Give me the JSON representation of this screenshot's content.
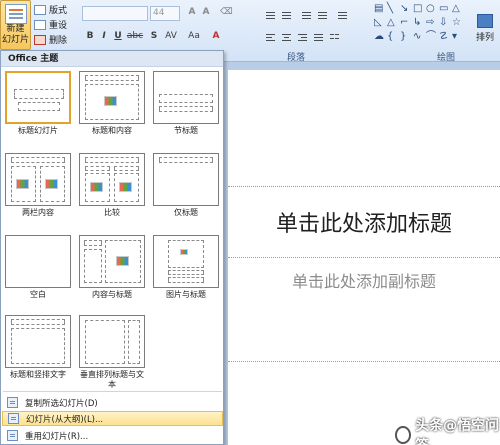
{
  "ribbon": {
    "new_slide_label_1": "新建",
    "new_slide_label_2": "幻灯片",
    "layout_label": "版式",
    "reset_label": "重设",
    "delete_label": "删除",
    "font_size": "44",
    "bold": "B",
    "italic": "I",
    "underline": "U",
    "strike": "abc",
    "shadow": "S",
    "spacing": "AV",
    "paragraph_group": "段落",
    "drawing_group": "绘图",
    "arrange_label": "排列"
  },
  "menu": {
    "header": "Office 主题",
    "layouts": [
      {
        "label": "标题幻灯片"
      },
      {
        "label": "标题和内容"
      },
      {
        "label": "节标题"
      },
      {
        "label": "两栏内容"
      },
      {
        "label": "比较"
      },
      {
        "label": "仅标题"
      },
      {
        "label": "空白"
      },
      {
        "label": "内容与标题"
      },
      {
        "label": "图片与标题"
      },
      {
        "label": "标题和竖排文字"
      },
      {
        "label": "垂直排列标题与文本"
      }
    ],
    "commands": [
      {
        "label": "复制所选幻灯片(D)"
      },
      {
        "label": "幻灯片(从大纲)(L)..."
      },
      {
        "label": "重用幻灯片(R)..."
      }
    ]
  },
  "slide": {
    "title_placeholder": "单击此处添加标题",
    "subtitle_placeholder": "单击此处添加副标题"
  },
  "watermark": "头条@悟空问答"
}
